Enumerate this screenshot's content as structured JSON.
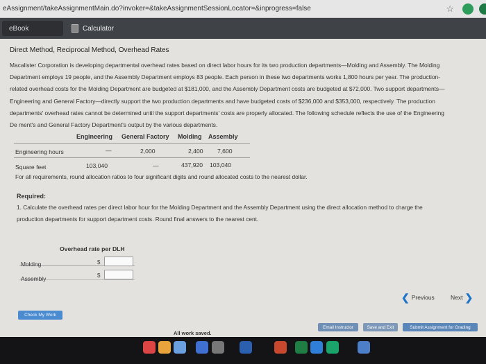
{
  "browser": {
    "url": "eAssignment/takeAssignmentMain.do?invoker=&takeAssignmentSessionLocator=&inprogress=false",
    "icons": [
      "star-icon",
      "extension-icon"
    ]
  },
  "toolbar": {
    "ebook_label": "eBook",
    "calculator_label": "Calculator"
  },
  "problem": {
    "title": "Direct Method, Reciprocal Method, Overhead Rates",
    "lines": [
      "Macalister Corporation is developing departmental overhead rates based on direct labor hours for its two production departments—Molding and Assembly. The Molding",
      "Department employs 19 people, and the Assembly Department employs 83 people. Each person in these two departments works 1,800 hours per year. The production-",
      "related overhead costs for the Molding Department are budgeted at $181,000, and the Assembly Department costs are budgeted at $72,000. Two support departments—",
      "Engineering and General Factory—directly support the two production departments and have budgeted costs of $236,000 and $353,000, respectively. The production",
      "departments' overhead rates cannot be determined until the support departments' costs are properly allocated. The following schedule reflects the use of the Engineering",
      "De   ment's and General Factory Department's output by the various departments."
    ]
  },
  "schedule": {
    "headers": [
      "Engineering",
      "General Factory",
      "Molding",
      "Assembly"
    ],
    "rows": [
      {
        "label": "Engineering hours",
        "values": [
          "—",
          "2,000",
          "2,400",
          "7,600"
        ]
      },
      {
        "label": "Square feet",
        "values": [
          "103,040",
          "—",
          "437,920",
          "103,040"
        ]
      }
    ]
  },
  "note": "For all requirements, round allocation ratios to four significant digits and round allocated costs to the nearest dollar.",
  "required": {
    "heading": "Required:",
    "line1": "1. Calculate the overhead rates per direct labor hour for the Molding Department and the Assembly Department using the direct allocation method to charge the",
    "line2": "production departments for support department costs. Round final answers to the nearest cent."
  },
  "answer_table": {
    "header": "Overhead rate per DLH",
    "rows": [
      {
        "label": "Molding",
        "currency": "$",
        "value": ""
      },
      {
        "label": "Assembly",
        "currency": "$",
        "value": ""
      }
    ]
  },
  "navigation": {
    "previous": "Previous",
    "next": "Next"
  },
  "footer": {
    "check_my_work": "Check My Work",
    "status": "All work saved.",
    "email_instructor": "Email Instructor",
    "save_and_exit": "Save and Exit",
    "submit": "Submit Assignment for Grading"
  },
  "colors": {
    "accent": "#1e74c8",
    "check_button": "#4b8bd0",
    "content_bg": "#e4e2de",
    "toolbar_bg": "#3f4247"
  }
}
